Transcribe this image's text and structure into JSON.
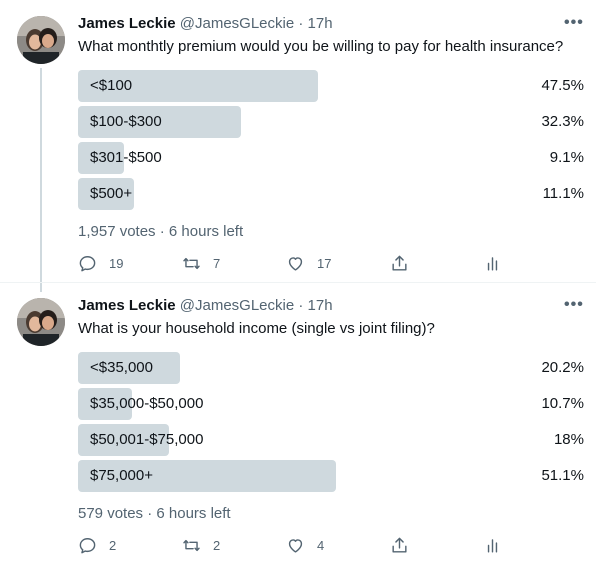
{
  "tweets": [
    {
      "author_name": "James Leckie",
      "author_handle": "@JamesGLeckie",
      "separator": "·",
      "time": "17h",
      "more": "•••",
      "question": "What monthtly premium would you be willing to pay for health insurance?",
      "options": [
        {
          "label": "<$100",
          "percent": "47.5%",
          "fraction": 0.475
        },
        {
          "label": "$100-$300",
          "percent": "32.3%",
          "fraction": 0.323
        },
        {
          "label": "$301-$500",
          "percent": "9.1%",
          "fraction": 0.091
        },
        {
          "label": "$500+",
          "percent": "11.1%",
          "fraction": 0.111
        }
      ],
      "votes": "1,957 votes",
      "time_left": "6 hours left",
      "replies": "19",
      "retweets": "7",
      "likes": "17"
    },
    {
      "author_name": "James Leckie",
      "author_handle": "@JamesGLeckie",
      "separator": "·",
      "time": "17h",
      "more": "•••",
      "question": "What is your household income (single vs joint filing)?",
      "options": [
        {
          "label": "<$35,000",
          "percent": "20.2%",
          "fraction": 0.202
        },
        {
          "label": "$35,000-$50,000",
          "percent": "10.7%",
          "fraction": 0.107
        },
        {
          "label": "$50,001-$75,000",
          "percent": "18%",
          "fraction": 0.18
        },
        {
          "label": "$75,000+",
          "percent": "51.1%",
          "fraction": 0.511
        }
      ],
      "votes": "579 votes",
      "time_left": "6 hours left",
      "replies": "2",
      "retweets": "2",
      "likes": "4"
    }
  ],
  "colors": {
    "bar": "#cfd9de",
    "muted": "#536471",
    "text": "#0f1419",
    "thread": "#cfd9de"
  },
  "icons": [
    "avatar",
    "reply-icon",
    "retweet-icon",
    "like-icon",
    "share-icon",
    "analytics-icon",
    "more-icon"
  ]
}
